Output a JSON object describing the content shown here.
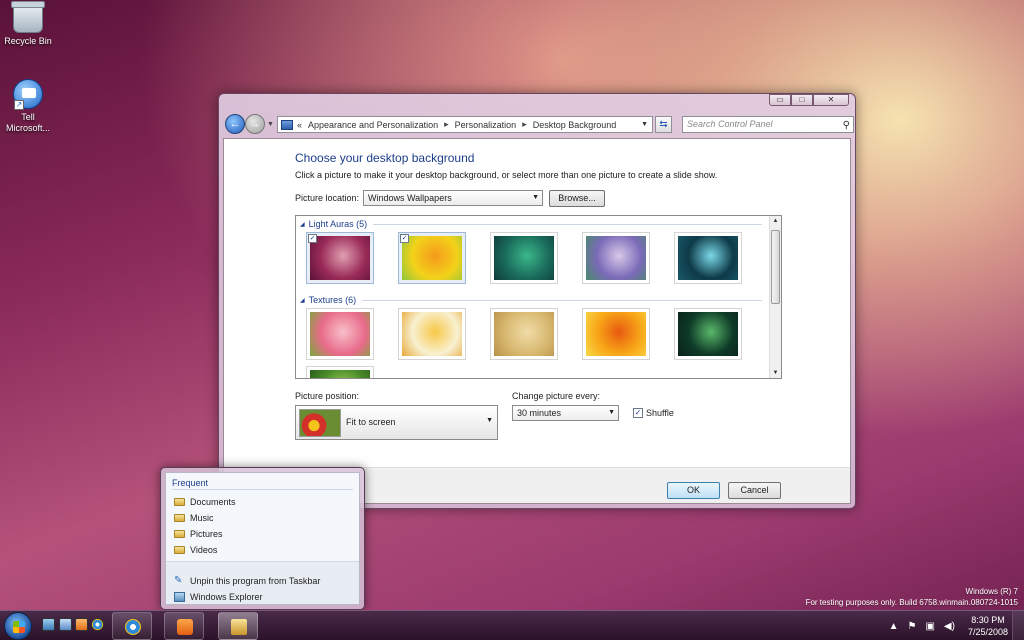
{
  "desktop": {
    "icons": [
      {
        "label": "Recycle Bin"
      },
      {
        "label": "Tell Microsoft..."
      }
    ]
  },
  "window": {
    "controls": {
      "minimize": "▭",
      "maximize": "□",
      "close": "✕"
    },
    "address": {
      "prefix": "«",
      "crumbs": [
        "Appearance and Personalization",
        "Personalization",
        "Desktop Background"
      ],
      "separator": "▸"
    },
    "search": {
      "placeholder": "Search Control Panel"
    },
    "heading": "Choose your desktop background",
    "subtitle": "Click a picture to make it your desktop background, or select more than one picture to create a slide show.",
    "picture_location": {
      "label": "Picture location:",
      "value": "Windows Wallpapers"
    },
    "browse_label": "Browse...",
    "gallery": {
      "groups": [
        {
          "title": "Light Auras (5)",
          "items": [
            {
              "checked": true,
              "colors": [
                "#9a2a58",
                "#e0a0b0",
                "#5a1238"
              ]
            },
            {
              "checked": true,
              "colors": [
                "#f3d21a",
                "#f59a1a",
                "#8fc63a"
              ]
            },
            {
              "checked": false,
              "colors": [
                "#1a6a5a",
                "#3ab88a",
                "#0e3a3a"
              ]
            },
            {
              "checked": false,
              "colors": [
                "#7a6ab8",
                "#d8c8e8",
                "#4a8a6a"
              ]
            },
            {
              "checked": false,
              "colors": [
                "#0e3a48",
                "#7ad8e8",
                "#1a5a6a"
              ]
            }
          ]
        },
        {
          "title": "Textures (6)",
          "items": [
            {
              "checked": false,
              "colors": [
                "#e86a8a",
                "#f8c0c8",
                "#7aa83a"
              ]
            },
            {
              "checked": false,
              "colors": [
                "#f8f0d0",
                "#f8c848",
                "#e8a838"
              ]
            },
            {
              "checked": false,
              "colors": [
                "#d8b870",
                "#f0dca8",
                "#b89048"
              ]
            },
            {
              "checked": false,
              "colors": [
                "#f8a818",
                "#e85a10",
                "#f8d848"
              ]
            },
            {
              "checked": false,
              "colors": [
                "#0e3a28",
                "#5ab86a",
                "#0a2218"
              ]
            },
            {
              "checked": false,
              "colors": [
                "#4a8a2a",
                "#a8d858",
                "#2a5a18"
              ]
            }
          ]
        }
      ]
    },
    "picture_position": {
      "label": "Picture position:",
      "value": "Fit to screen"
    },
    "change_picture": {
      "label": "Change picture every:",
      "value": "30 minutes"
    },
    "shuffle": {
      "label": "Shuffle",
      "checked": true
    },
    "ok_label": "OK",
    "cancel_label": "Cancel"
  },
  "jumplist": {
    "section": "Frequent",
    "items": [
      "Documents",
      "Music",
      "Pictures",
      "Videos"
    ],
    "tasks": [
      "Unpin this program from Taskbar",
      "Windows Explorer"
    ]
  },
  "watermark": {
    "line1": "Windows (R) 7",
    "line2": "For testing purposes only. Build 6758.winmain.080724-1015"
  },
  "taskbar": {
    "time": "8:30 PM",
    "date": "7/25/2008"
  }
}
